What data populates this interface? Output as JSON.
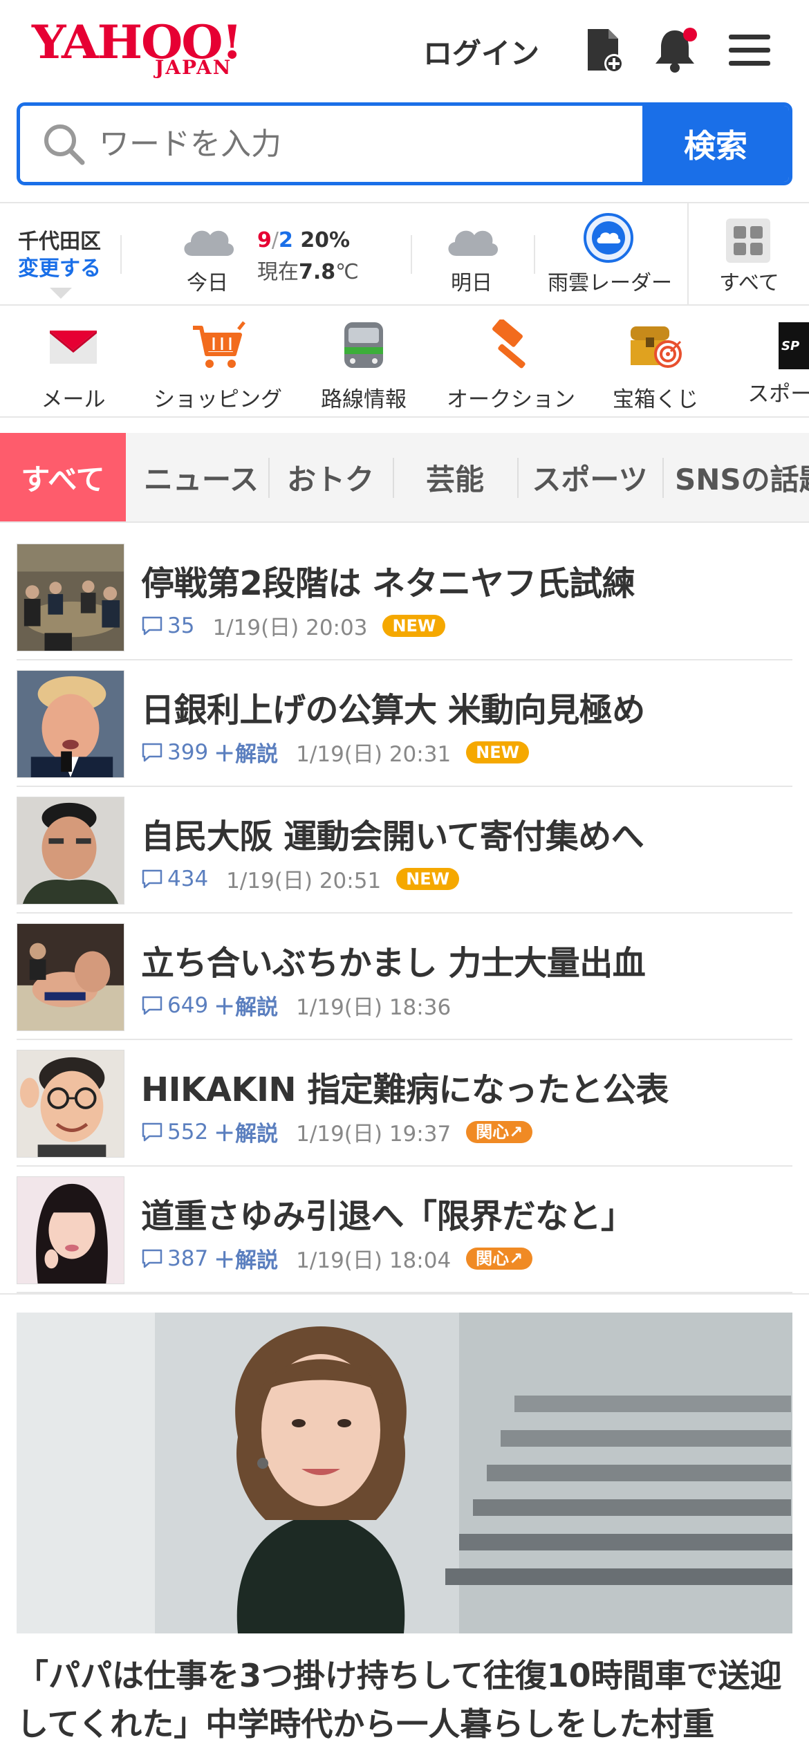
{
  "header": {
    "logo_main": "YAHOO!",
    "logo_sub": "JAPAN",
    "login_label": "ログイン"
  },
  "search": {
    "placeholder": "ワードを入力",
    "button_label": "検索"
  },
  "weather": {
    "location": "千代田区",
    "change_label": "変更する",
    "today_label": "今日",
    "temp_high": "9",
    "temp_sep": "/",
    "temp_low": "2",
    "precip": "20%",
    "now_prefix": "現在",
    "now_temp": "7.8",
    "now_unit": "℃",
    "tomorrow_label": "明日",
    "radar_label": "雨雲レーダー",
    "all_label": "すべて"
  },
  "services": [
    {
      "label": "メール",
      "icon": "mail-icon"
    },
    {
      "label": "ショッピング",
      "icon": "shopping-cart-icon"
    },
    {
      "label": "路線情報",
      "icon": "train-icon"
    },
    {
      "label": "オークション",
      "icon": "auction-hammer-icon"
    },
    {
      "label": "宝箱くじ",
      "icon": "treasure-box-icon"
    },
    {
      "label": "スポーツ",
      "icon": "sports-icon"
    }
  ],
  "tabs": [
    "すべて",
    "ニュース",
    "おトク",
    "芸能",
    "スポーツ",
    "SNSの話題"
  ],
  "news": [
    {
      "title": "停戦第2段階は ネタニヤフ氏試練",
      "comments": "35",
      "kaisetsu": "",
      "date": "1/19(日) 20:03",
      "badge": "NEW",
      "badge_type": "new"
    },
    {
      "title": "日銀利上げの公算大 米動向見極め",
      "comments": "399",
      "kaisetsu": "＋解説",
      "date": "1/19(日) 20:31",
      "badge": "NEW",
      "badge_type": "new"
    },
    {
      "title": "自民大阪 運動会開いて寄付集めへ",
      "comments": "434",
      "kaisetsu": "",
      "date": "1/19(日) 20:51",
      "badge": "NEW",
      "badge_type": "new"
    },
    {
      "title": "立ち合いぶちかまし 力士大量出血",
      "comments": "649",
      "kaisetsu": "＋解説",
      "date": "1/19(日) 18:36",
      "badge": "",
      "badge_type": ""
    },
    {
      "title": "HIKAKIN 指定難病になったと公表",
      "comments": "552",
      "kaisetsu": "＋解説",
      "date": "1/19(日) 19:37",
      "badge": "関心↗",
      "badge_type": "kan"
    },
    {
      "title": "道重さゆみ引退へ「限界だなと」",
      "comments": "387",
      "kaisetsu": "＋解説",
      "date": "1/19(日) 18:04",
      "badge": "関心↗",
      "badge_type": "kan"
    }
  ],
  "feature": {
    "title": "「パパは仕事を3つ掛け持ちして往復10時間車で送迎してくれた」中学時代から一人暮らしをした村重"
  },
  "colors": {
    "brand_red": "#e60033",
    "search_blue": "#1a6fe8",
    "active_tab": "#fe5c6c",
    "new_badge": "#f5a800",
    "interest_badge": "#f08a24"
  }
}
